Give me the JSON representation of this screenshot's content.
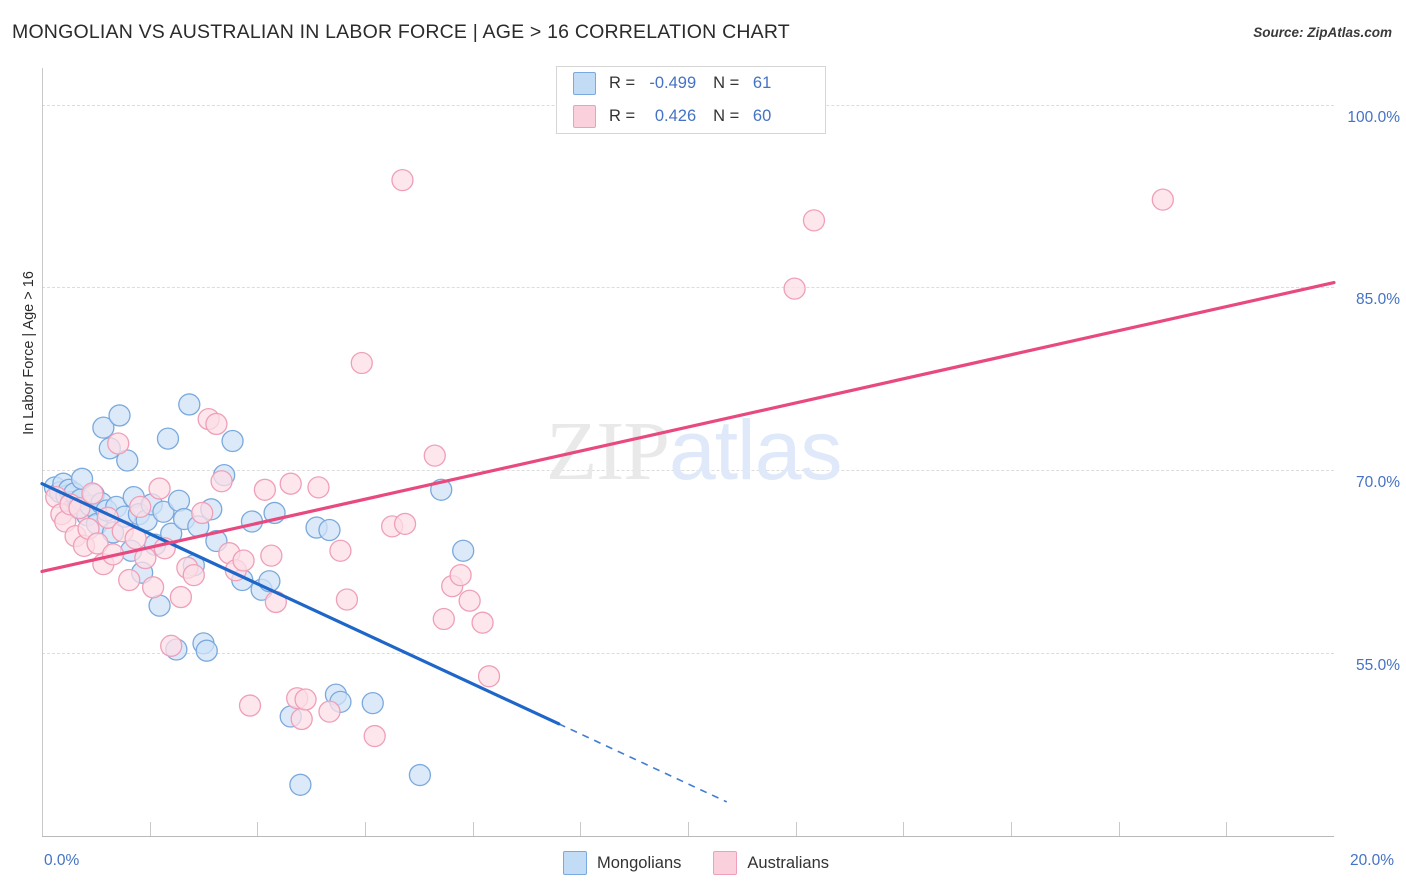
{
  "header": {
    "title": "MONGOLIAN VS AUSTRALIAN IN LABOR FORCE | AGE > 16 CORRELATION CHART",
    "source": "Source: ZipAtlas.com"
  },
  "watermark": {
    "part1": "ZIP",
    "part2": "atlas"
  },
  "stats": {
    "rows": [
      {
        "series": "Mongolians",
        "r_label": "R =",
        "r_value": "-0.499",
        "n_label": "N =",
        "n_value": "61",
        "color": "#c3dcf5"
      },
      {
        "series": "Australians",
        "r_label": "R =",
        "r_value": "0.426",
        "n_label": "N =",
        "n_value": "60",
        "color": "#fbd0dd"
      }
    ]
  },
  "legend": {
    "items": [
      {
        "label": "Mongolians",
        "color": "#c3dcf5",
        "border": "#7aa9dd"
      },
      {
        "label": "Australians",
        "color": "#fbd0dd",
        "border": "#ef9fb8"
      }
    ]
  },
  "chart_data": {
    "type": "scatter",
    "title": "MONGOLIAN VS AUSTRALIAN IN LABOR FORCE | AGE > 16 CORRELATION CHART",
    "xlabel": "",
    "ylabel": "In Labor Force | Age > 16",
    "xlim": [
      0,
      20
    ],
    "ylim": [
      40.0,
      103.0
    ],
    "grid": true,
    "legend_position": "bottom-center",
    "x_ticks": [
      "0.0%",
      "20.0%"
    ],
    "x_tick_values": [
      0,
      20
    ],
    "y_ticks": [
      "100.0%",
      "85.0%",
      "70.0%",
      "55.0%"
    ],
    "y_tick_values": [
      100.0,
      85.0,
      70.0,
      55.0
    ],
    "colors": {
      "blue_fill": "#cfe2f7",
      "blue_stroke": "#7aa9dd",
      "pink_fill": "#fcdde6",
      "pink_stroke": "#ef9fb8",
      "blue_line": "#1f66c9",
      "pink_line": "#e8497f",
      "gridline": "#dcdcdc",
      "tick_text": "#4472c4"
    },
    "series": [
      {
        "name": "Mongolians",
        "r": -0.499,
        "n": 61,
        "marker_fill": "#cfe2f7",
        "marker_stroke": "#7aa9dd",
        "trend": {
          "color": "#1f66c9",
          "x0": 0.0,
          "y0": 68.9,
          "x1": 8.0,
          "y1": 49.2,
          "dash_from_x": 8.0,
          "dash_to_x": 10.6
        },
        "points": [
          [
            0.2,
            68.6
          ],
          [
            0.28,
            68.2
          ],
          [
            0.33,
            68.9
          ],
          [
            0.38,
            67.9
          ],
          [
            0.42,
            68.4
          ],
          [
            0.45,
            67.4
          ],
          [
            0.5,
            68.1
          ],
          [
            0.55,
            66.9
          ],
          [
            0.6,
            67.6
          ],
          [
            0.62,
            69.3
          ],
          [
            0.7,
            66.3
          ],
          [
            0.75,
            67.1
          ],
          [
            0.8,
            68.0
          ],
          [
            0.85,
            65.6
          ],
          [
            0.92,
            67.3
          ],
          [
            0.95,
            73.5
          ],
          [
            1.0,
            66.7
          ],
          [
            1.05,
            71.8
          ],
          [
            1.1,
            64.9
          ],
          [
            1.15,
            67.0
          ],
          [
            1.2,
            74.5
          ],
          [
            1.28,
            66.2
          ],
          [
            1.32,
            70.8
          ],
          [
            1.38,
            63.4
          ],
          [
            1.42,
            67.8
          ],
          [
            1.5,
            66.4
          ],
          [
            1.55,
            61.6
          ],
          [
            1.62,
            65.9
          ],
          [
            1.7,
            67.2
          ],
          [
            1.75,
            63.9
          ],
          [
            1.82,
            58.9
          ],
          [
            1.88,
            66.6
          ],
          [
            1.95,
            72.6
          ],
          [
            2.0,
            64.8
          ],
          [
            2.08,
            55.3
          ],
          [
            2.12,
            67.5
          ],
          [
            2.2,
            66.0
          ],
          [
            2.28,
            75.4
          ],
          [
            2.35,
            62.2
          ],
          [
            2.42,
            65.4
          ],
          [
            2.5,
            55.8
          ],
          [
            2.55,
            55.2
          ],
          [
            2.62,
            66.8
          ],
          [
            2.7,
            64.2
          ],
          [
            2.82,
            69.6
          ],
          [
            2.95,
            72.4
          ],
          [
            3.1,
            61.0
          ],
          [
            3.25,
            65.8
          ],
          [
            3.4,
            60.2
          ],
          [
            3.52,
            60.9
          ],
          [
            3.6,
            66.5
          ],
          [
            3.85,
            49.8
          ],
          [
            4.0,
            44.2
          ],
          [
            4.25,
            65.3
          ],
          [
            4.45,
            65.1
          ],
          [
            4.55,
            51.6
          ],
          [
            4.62,
            51.0
          ],
          [
            5.12,
            50.9
          ],
          [
            5.85,
            45.0
          ],
          [
            6.18,
            68.4
          ],
          [
            6.52,
            63.4
          ]
        ]
      },
      {
        "name": "Australians",
        "r": 0.426,
        "n": 60,
        "marker_fill": "#fcdde6",
        "marker_stroke": "#ef9fb8",
        "trend": {
          "color": "#e8497f",
          "x0": 0.0,
          "y0": 61.7,
          "x1": 20.0,
          "y1": 85.4
        },
        "points": [
          [
            0.22,
            67.8
          ],
          [
            0.3,
            66.4
          ],
          [
            0.36,
            65.8
          ],
          [
            0.44,
            67.2
          ],
          [
            0.52,
            64.6
          ],
          [
            0.58,
            66.9
          ],
          [
            0.65,
            63.8
          ],
          [
            0.72,
            65.2
          ],
          [
            0.78,
            68.1
          ],
          [
            0.86,
            64.0
          ],
          [
            0.95,
            62.3
          ],
          [
            1.02,
            66.1
          ],
          [
            1.1,
            63.1
          ],
          [
            1.18,
            72.2
          ],
          [
            1.25,
            65.0
          ],
          [
            1.35,
            61.0
          ],
          [
            1.45,
            64.4
          ],
          [
            1.52,
            67.0
          ],
          [
            1.6,
            62.8
          ],
          [
            1.72,
            60.4
          ],
          [
            1.82,
            68.5
          ],
          [
            1.9,
            63.6
          ],
          [
            2.0,
            55.6
          ],
          [
            2.15,
            59.6
          ],
          [
            2.25,
            62.0
          ],
          [
            2.35,
            61.4
          ],
          [
            2.48,
            66.5
          ],
          [
            2.58,
            74.2
          ],
          [
            2.7,
            73.8
          ],
          [
            2.78,
            69.1
          ],
          [
            2.9,
            63.2
          ],
          [
            3.0,
            61.8
          ],
          [
            3.12,
            62.6
          ],
          [
            3.22,
            50.7
          ],
          [
            3.45,
            68.4
          ],
          [
            3.55,
            63.0
          ],
          [
            3.62,
            59.2
          ],
          [
            3.85,
            68.9
          ],
          [
            3.95,
            51.3
          ],
          [
            4.02,
            49.6
          ],
          [
            4.08,
            51.2
          ],
          [
            4.28,
            68.6
          ],
          [
            4.45,
            50.2
          ],
          [
            4.62,
            63.4
          ],
          [
            4.72,
            59.4
          ],
          [
            4.95,
            78.8
          ],
          [
            5.15,
            48.2
          ],
          [
            5.42,
            65.4
          ],
          [
            5.58,
            93.8
          ],
          [
            6.08,
            71.2
          ],
          [
            6.22,
            57.8
          ],
          [
            6.35,
            60.5
          ],
          [
            6.48,
            61.4
          ],
          [
            6.62,
            59.3
          ],
          [
            6.82,
            57.5
          ],
          [
            6.92,
            53.1
          ],
          [
            11.65,
            84.9
          ],
          [
            11.95,
            90.5
          ],
          [
            17.35,
            92.2
          ],
          [
            5.62,
            65.6
          ]
        ]
      }
    ]
  }
}
